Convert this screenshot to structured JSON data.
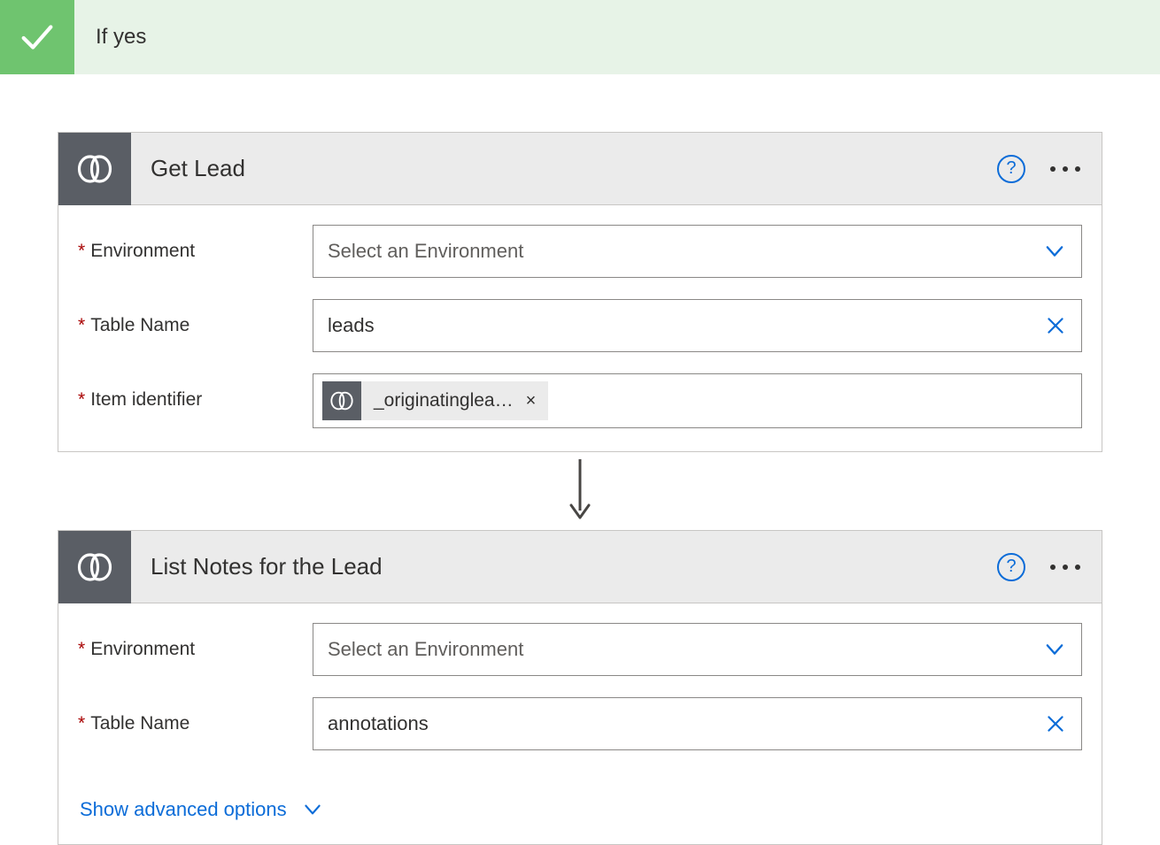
{
  "condition": {
    "branch_label": "If yes"
  },
  "cards": {
    "getLead": {
      "title": "Get Lead",
      "fields": {
        "environment": {
          "label": "Environment",
          "placeholder": "Select an Environment"
        },
        "tableName": {
          "label": "Table Name",
          "value": "leads"
        },
        "itemIdentifier": {
          "label": "Item identifier",
          "token_label": "_originatinglea…",
          "token_remove": "×"
        }
      }
    },
    "listNotes": {
      "title": "List Notes for the Lead",
      "fields": {
        "environment": {
          "label": "Environment",
          "placeholder": "Select an Environment"
        },
        "tableName": {
          "label": "Table Name",
          "value": "annotations"
        }
      },
      "show_advanced": "Show advanced options"
    }
  },
  "ui": {
    "help_tooltip": "?",
    "required_mark": "*"
  }
}
